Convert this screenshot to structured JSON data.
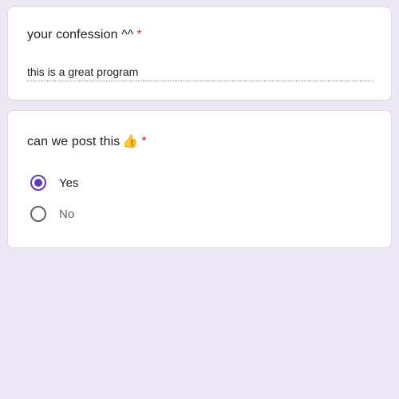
{
  "colors": {
    "background": "#ede7f6",
    "accent": "#673ab7",
    "required": "#d93025"
  },
  "questions": [
    {
      "title": "your confession ^^",
      "required_mark": "*",
      "answer": "this is a great program"
    },
    {
      "title": "can we post this",
      "emoji": "👍",
      "emoji_icon": "thumbs-up-icon",
      "required_mark": "*",
      "options": [
        {
          "label": "Yes",
          "selected": true
        },
        {
          "label": "No",
          "selected": false
        }
      ]
    }
  ]
}
